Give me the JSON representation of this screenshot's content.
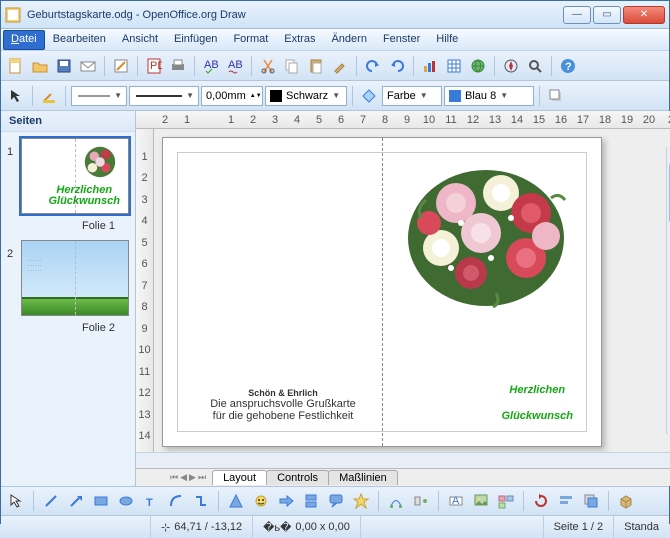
{
  "window": {
    "title": "Geburtstagskarte.odg - OpenOffice.org Draw"
  },
  "menu": {
    "datei": "Datei",
    "bearbeiten": "Bearbeiten",
    "ansicht": "Ansicht",
    "einfuegen": "Einfügen",
    "format": "Format",
    "extras": "Extras",
    "aendern": "Ändern",
    "fenster": "Fenster",
    "hilfe": "Hilfe"
  },
  "toolbar2": {
    "line_width": "0,00mm",
    "line_color_label": "Schwarz",
    "fill_label": "Farbe",
    "fill_color_label": "Blau 8"
  },
  "sidebar": {
    "header": "Seiten",
    "slides": [
      {
        "num": "1",
        "label": "Folie 1"
      },
      {
        "num": "2",
        "label": "Folie 2"
      }
    ]
  },
  "ruler_h": [
    "2",
    "1",
    "",
    "1",
    "2",
    "3",
    "4",
    "5",
    "6",
    "7",
    "8",
    "9",
    "10",
    "11",
    "12",
    "13",
    "14",
    "15",
    "16",
    "17",
    "18",
    "19",
    "20",
    "2"
  ],
  "ruler_v": [
    "",
    "1",
    "2",
    "3",
    "4",
    "5",
    "6",
    "7",
    "8",
    "9",
    "10",
    "11",
    "12",
    "13",
    "14"
  ],
  "card": {
    "greeting_line1": "Herzlichen",
    "greeting_line2": "Glückwunsch",
    "brand": "Schön & Ehrlich",
    "tagline": "Die anspruchsvolle Grußkarte für die gehobene Festlichkeit"
  },
  "tabs": {
    "layout": "Layout",
    "controls": "Controls",
    "masslinien": "Maßlinien"
  },
  "status": {
    "coords": "64,71 / -13,12",
    "size": "0,00 x 0,00",
    "page": "Seite 1 / 2",
    "layout": "Standa"
  },
  "colors": {
    "black": "#000000",
    "blue8": "#3a7ad9"
  }
}
